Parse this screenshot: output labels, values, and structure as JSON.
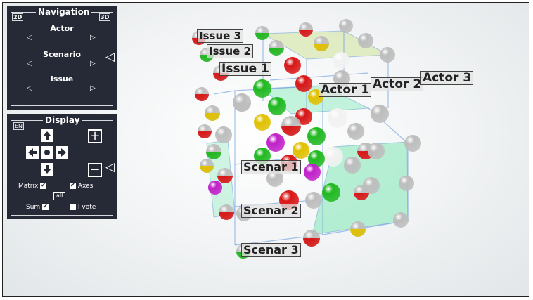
{
  "navigation": {
    "title": "Navigation",
    "mode_2d": "2D",
    "mode_3d": "3D",
    "rows": [
      "Actor",
      "Scenario",
      "Issue"
    ]
  },
  "display": {
    "title": "Display",
    "lang": "EN",
    "plus": "+",
    "minus": "−",
    "matrix_label": "Matrix",
    "axes_label": "Axes",
    "all_label": "all",
    "sum_label": "Sum",
    "ivote_label": "I vote"
  },
  "labels": {
    "issue1": "Issue 1",
    "issue2": "Issue 2",
    "issue3": "Issue 3",
    "actor1": "Actor 1",
    "actor2": "Actor 2",
    "actor3": "Actor 3",
    "scenario1": "Scenar 1",
    "scenario2": "Scenar 2",
    "scenario3": "Scenar 3"
  },
  "colors": {
    "panel": "#262a37",
    "red": "#d81616",
    "green": "#20b820",
    "yellow": "#e0c000",
    "magenta": "#c020c8",
    "white": "#f2f2f2",
    "grey": "#bdbdbd",
    "plane_green": "#7fe8b5",
    "plane_lime": "#cfe39a",
    "edge": "#6a9ae0"
  }
}
